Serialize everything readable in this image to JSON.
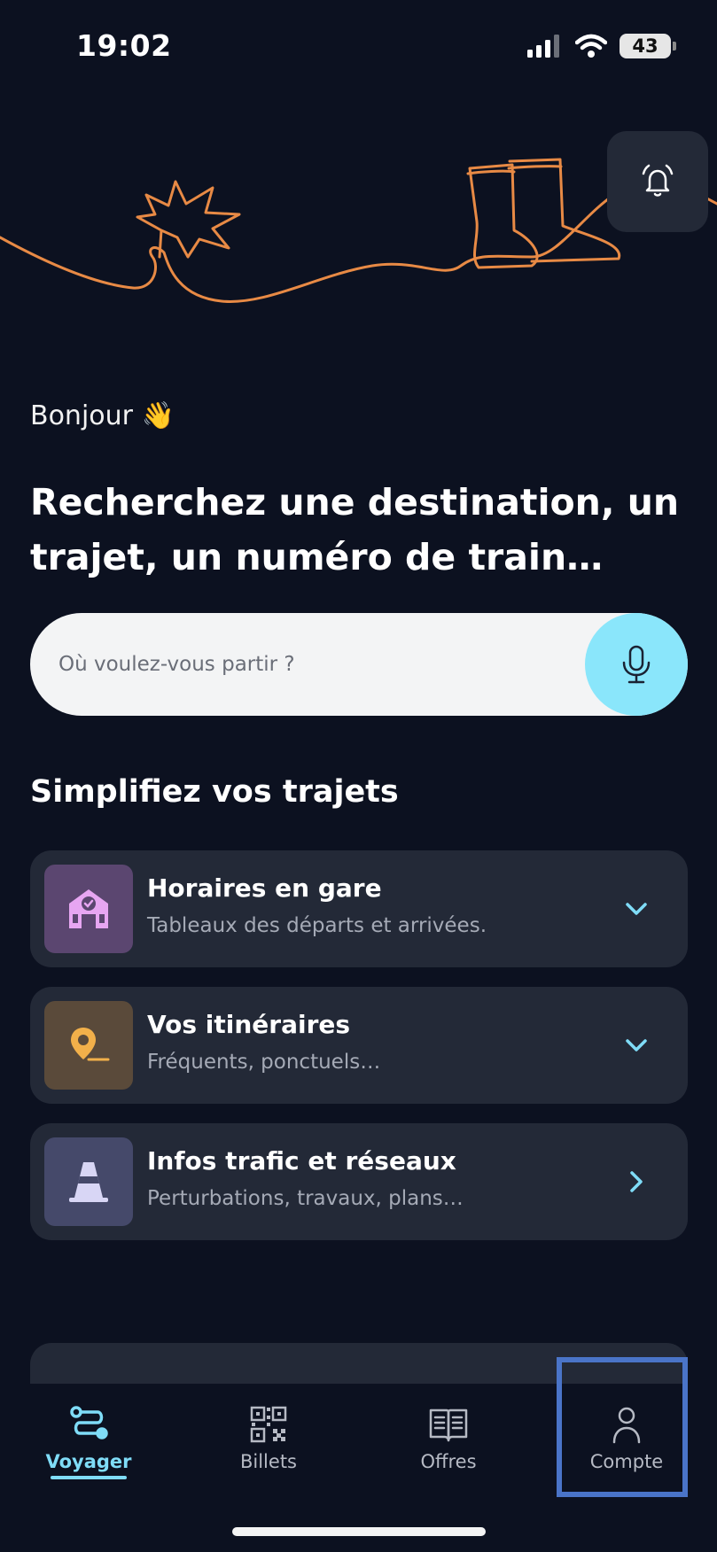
{
  "status": {
    "time": "19:02",
    "battery": "43"
  },
  "hero": {
    "accent_color": "#e88a45"
  },
  "greeting": {
    "text": "Bonjour",
    "emoji": "👋"
  },
  "headline": "Recherchez une destination, un trajet, un numéro de train…",
  "search": {
    "placeholder": "Où voulez-vous partir ?"
  },
  "section_title": "Simplifiez vos trajets",
  "cards": [
    {
      "title": "Horaires en gare",
      "subtitle": "Tableaux des départs et arrivées.",
      "icon": "station-icon",
      "icon_bg": "#5b4670",
      "chevron": "chevron-down-icon"
    },
    {
      "title": "Vos itinéraires",
      "subtitle": "Fréquents, ponctuels…",
      "icon": "location-pin-icon",
      "icon_bg": "#5a4a3a",
      "chevron": "chevron-down-icon"
    },
    {
      "title": "Infos trafic et réseaux",
      "subtitle": "Perturbations, travaux, plans…",
      "icon": "traffic-cone-icon",
      "icon_bg": "#45496a",
      "chevron": "chevron-right-icon"
    }
  ],
  "tabs": [
    {
      "label": "Voyager",
      "icon": "route-icon",
      "active": true
    },
    {
      "label": "Billets",
      "icon": "qr-code-icon",
      "active": false
    },
    {
      "label": "Offres",
      "icon": "book-icon",
      "active": false
    },
    {
      "label": "Compte",
      "icon": "user-icon",
      "active": false
    }
  ],
  "colors": {
    "background": "#0c1120",
    "card": "#232937",
    "accent": "#7fdcf7",
    "mic": "#8ae6fb",
    "highlight": "#4a74c8"
  }
}
